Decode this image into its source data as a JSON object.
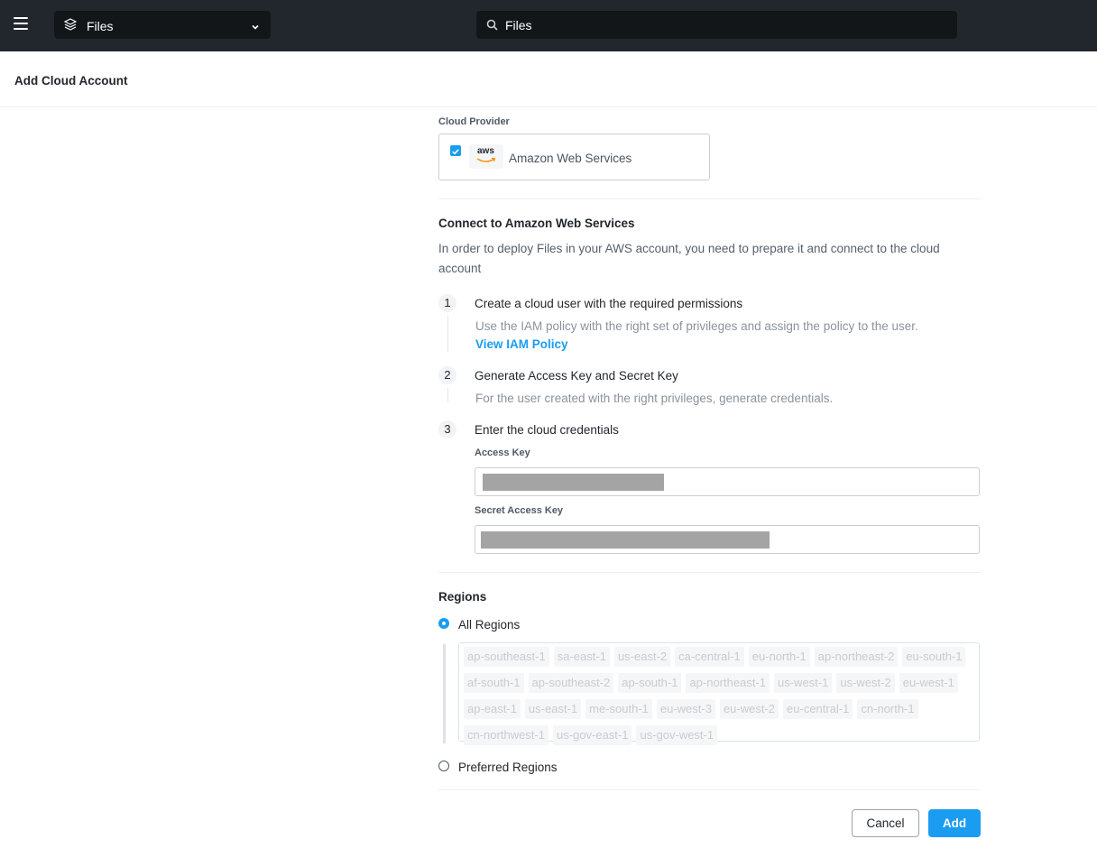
{
  "topbar": {
    "menu_icon": "hamburger-icon",
    "app_switcher": {
      "icon": "files-stack-icon",
      "label": "Files",
      "chevron": "chevron-down-icon"
    },
    "search": {
      "icon": "search-icon",
      "value": "Files"
    }
  },
  "page": {
    "title": "Add Cloud Account"
  },
  "provider": {
    "label": "Cloud Provider",
    "name": "Amazon Web Services",
    "logo_text": "aws",
    "checked": true
  },
  "connect": {
    "title": "Connect to Amazon Web Services",
    "description": "In order to deploy Files in your AWS account, you need to prepare it and connect to the cloud account"
  },
  "steps": [
    {
      "number": "1",
      "title": "Create a cloud user with the required permissions",
      "description": "Use the IAM policy with the right set of privileges and assign the policy to the user.",
      "link": "View IAM Policy"
    },
    {
      "number": "2",
      "title": "Generate Access Key and Secret Key",
      "description": "For the user created with the right privileges, generate credentials."
    },
    {
      "number": "3",
      "title": "Enter the cloud credentials"
    }
  ],
  "credentials": {
    "access_key_label": "Access Key",
    "secret_key_label": "Secret Access Key"
  },
  "regions": {
    "title": "Regions",
    "all_label": "All Regions",
    "preferred_label": "Preferred Regions",
    "selected": "All Regions",
    "list": [
      "ap-southeast-1",
      "sa-east-1",
      "us-east-2",
      "ca-central-1",
      "eu-north-1",
      "ap-northeast-2",
      "eu-south-1",
      "af-south-1",
      "ap-southeast-2",
      "ap-south-1",
      "ap-northeast-1",
      "us-west-1",
      "us-west-2",
      "eu-west-1",
      "ap-east-1",
      "us-east-1",
      "me-south-1",
      "eu-west-3",
      "eu-west-2",
      "eu-central-1",
      "cn-north-1",
      "cn-northwest-1",
      "us-gov-east-1",
      "us-gov-west-1"
    ]
  },
  "actions": {
    "cancel": "Cancel",
    "add": "Add"
  },
  "colors": {
    "topbar": "#22272e",
    "accent": "#1a9cf0",
    "redaction": "#a4a4a4"
  }
}
